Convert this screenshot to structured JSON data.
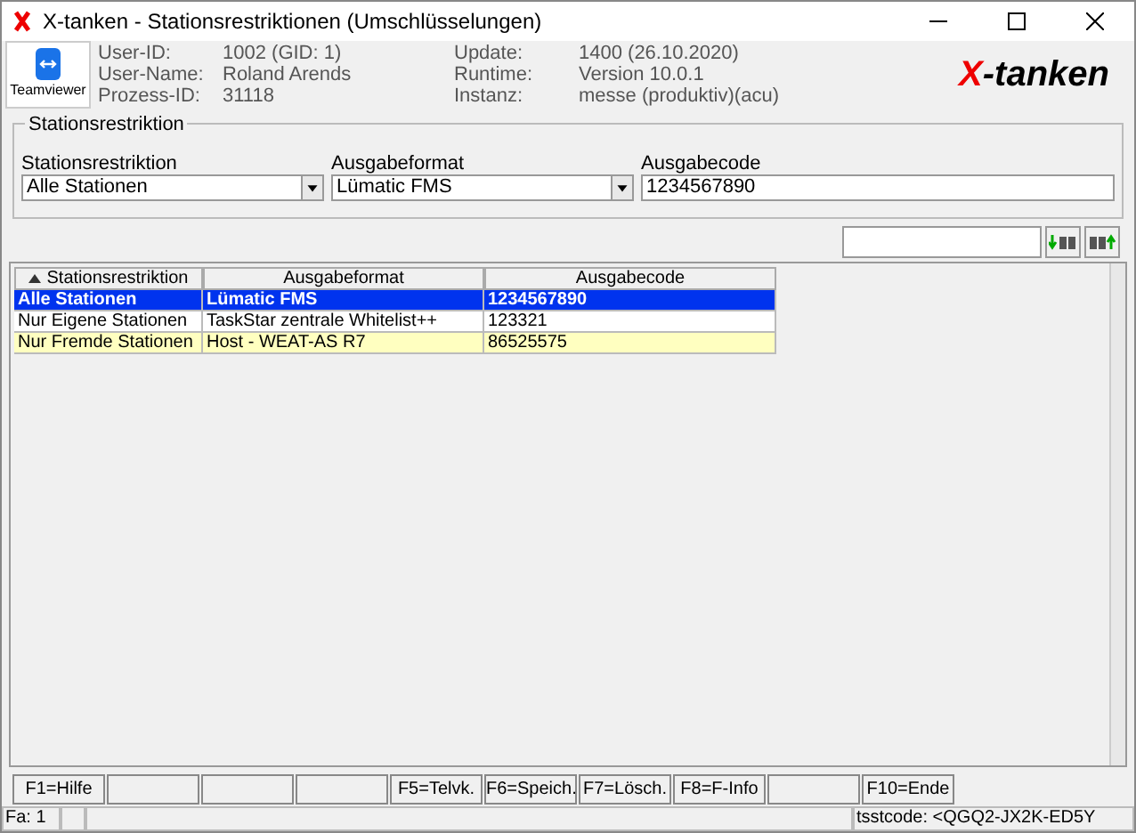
{
  "window": {
    "title": "X-tanken - Stationsrestriktionen (Umschlüsselungen)"
  },
  "header": {
    "teamviewer_label": "Teamviewer",
    "logo": "X-tanken",
    "info": [
      {
        "label": "User-ID:",
        "value": "1002 (GID: 1)"
      },
      {
        "label": "User-Name:",
        "value": "Roland Arends"
      },
      {
        "label": "Prozess-ID:",
        "value": "31118"
      },
      {
        "label": "Update:",
        "value": "1400 (26.10.2020)"
      },
      {
        "label": "Runtime:",
        "value": "Version 10.0.1"
      },
      {
        "label": "Instanz:",
        "value": "messe (produktiv)(acu)"
      }
    ]
  },
  "group": {
    "title": "Stationsrestriktion",
    "fields": [
      {
        "label": "Stationsrestriktion",
        "value": "Alle Stationen",
        "kind": "dropdown"
      },
      {
        "label": "Ausgabeformat",
        "value": "Lümatic FMS",
        "kind": "dropdown"
      },
      {
        "label": "Ausgabecode",
        "value": "1234567890",
        "kind": "text"
      }
    ]
  },
  "table": {
    "columns": [
      "Stationsrestriktion",
      "Ausgabeformat",
      "Ausgabecode"
    ],
    "rows": [
      {
        "cells": [
          "Alle Stationen",
          "Lümatic FMS",
          "1234567890"
        ],
        "selected": true,
        "highlighted": false
      },
      {
        "cells": [
          "Nur Eigene Stationen",
          "TaskStar zentrale Whitelist++",
          "123321"
        ],
        "selected": false,
        "highlighted": false
      },
      {
        "cells": [
          "Nur Fremde Stationen",
          "Host - WEAT-AS R7",
          "86525575"
        ],
        "selected": false,
        "highlighted": true
      }
    ]
  },
  "function_keys": [
    {
      "kind": "key",
      "label": "F1=Hilfe"
    },
    {
      "kind": "blank"
    },
    {
      "kind": "blank"
    },
    {
      "kind": "blank"
    },
    {
      "kind": "key",
      "label": "F5=Telvk."
    },
    {
      "kind": "key",
      "label": "F6=Speich."
    },
    {
      "kind": "key",
      "label": "F7=Lösch."
    },
    {
      "kind": "key",
      "label": "F8=F-Info"
    },
    {
      "kind": "blank"
    },
    {
      "kind": "key",
      "label": "F10=Ende"
    }
  ],
  "status_bar": {
    "left": "Fa: 1",
    "right": "tsstcode: <QGQ2-JX2K-ED5Y"
  }
}
